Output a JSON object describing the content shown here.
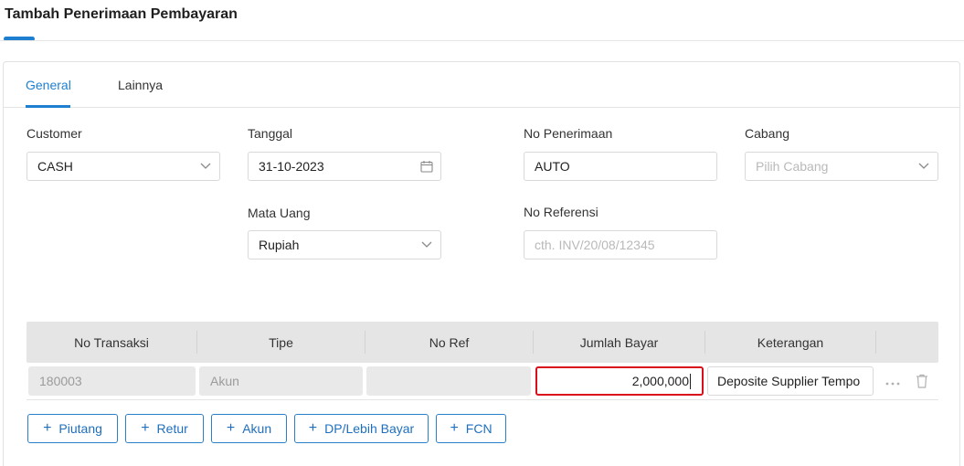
{
  "page": {
    "title": "Tambah Penerimaan Pembayaran"
  },
  "tabs": [
    {
      "label": "General",
      "active": true
    },
    {
      "label": "Lainnya",
      "active": false
    }
  ],
  "form": {
    "customer": {
      "label": "Customer",
      "value": "CASH"
    },
    "tanggal": {
      "label": "Tanggal",
      "value": "31-10-2023"
    },
    "no_penerimaan": {
      "label": "No Penerimaan",
      "value": "AUTO"
    },
    "cabang": {
      "label": "Cabang",
      "placeholder": "Pilih Cabang"
    },
    "mata_uang": {
      "label": "Mata Uang",
      "value": "Rupiah"
    },
    "no_referensi": {
      "label": "No Referensi",
      "placeholder": "cth. INV/20/08/12345"
    }
  },
  "table": {
    "columns": [
      "No Transaksi",
      "Tipe",
      "No Ref",
      "Jumlah Bayar",
      "Keterangan"
    ],
    "rows": [
      {
        "no_transaksi": "180003",
        "tipe": "Akun",
        "no_ref": "",
        "jumlah_bayar": "2,000,000",
        "keterangan": "Deposite Supplier Tempo"
      }
    ]
  },
  "add_buttons": [
    "Piutang",
    "Retur",
    "Akun",
    "DP/Lebih Bayar",
    "FCN"
  ],
  "colors": {
    "accent": "#1e7fd0",
    "focus_border": "#d9101c"
  }
}
